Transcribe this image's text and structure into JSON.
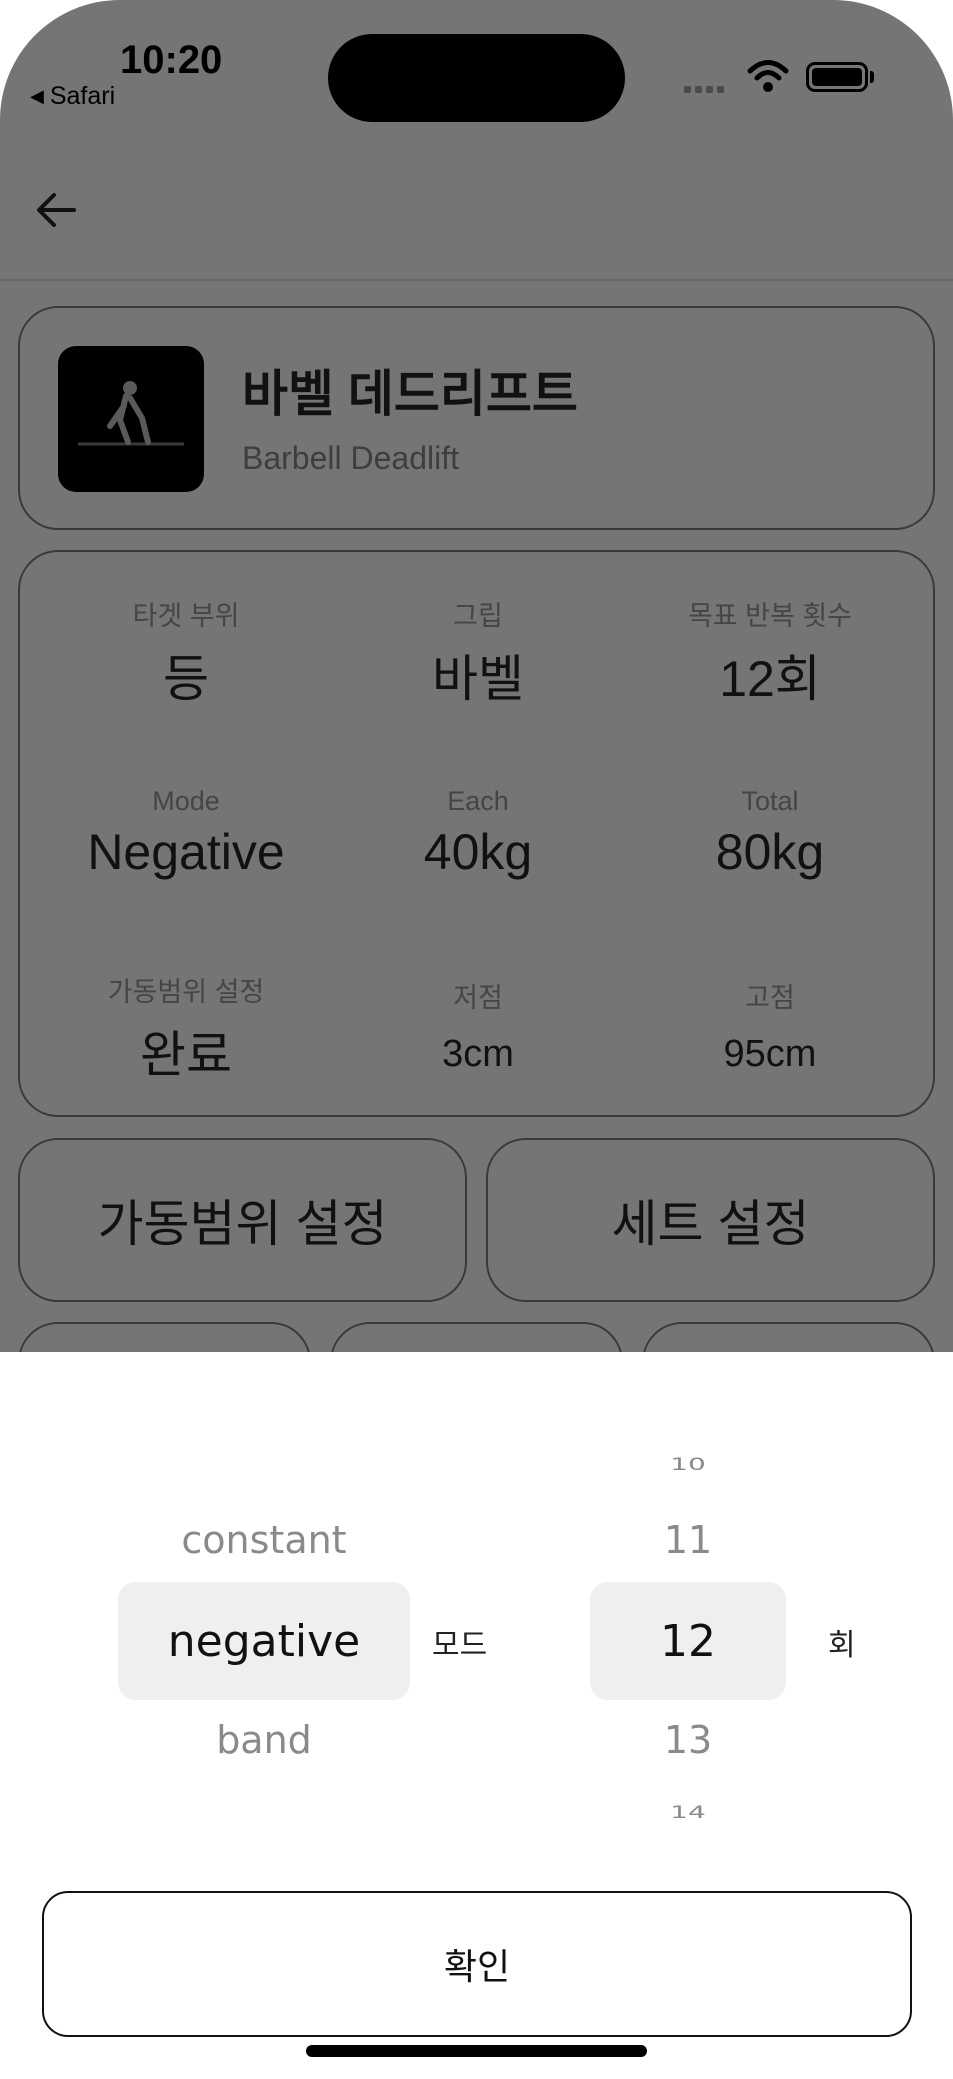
{
  "status_bar": {
    "time": "10:20",
    "back_app": "Safari"
  },
  "exercise": {
    "name_ko": "바벨 데드리프트",
    "name_en": "Barbell Deadlift"
  },
  "info": {
    "target_label": "타겟 부위",
    "target_value": "등",
    "grip_label": "그립",
    "grip_value": "바벨",
    "reps_label": "목표 반복 횟수",
    "reps_value": "12회",
    "mode_label": "Mode",
    "mode_value": "Negative",
    "each_label": "Each",
    "each_value": "40kg",
    "total_label": "Total",
    "total_value": "80kg",
    "rom_label": "가동범위 설정",
    "rom_value": "완료",
    "low_label": "저점",
    "low_value": "3cm",
    "high_label": "고점",
    "high_value": "95cm"
  },
  "buttons": {
    "range_setting": "가동범위 설정",
    "set_setting": "세트 설정"
  },
  "picker": {
    "mode_options": [
      "constant",
      "negative",
      "band"
    ],
    "mode_selected": "negative",
    "mode_unit": "모드",
    "reps_options": [
      "10",
      "11",
      "12",
      "13",
      "14"
    ],
    "reps_selected": "12",
    "reps_unit": "회"
  },
  "confirm_label": "확인"
}
